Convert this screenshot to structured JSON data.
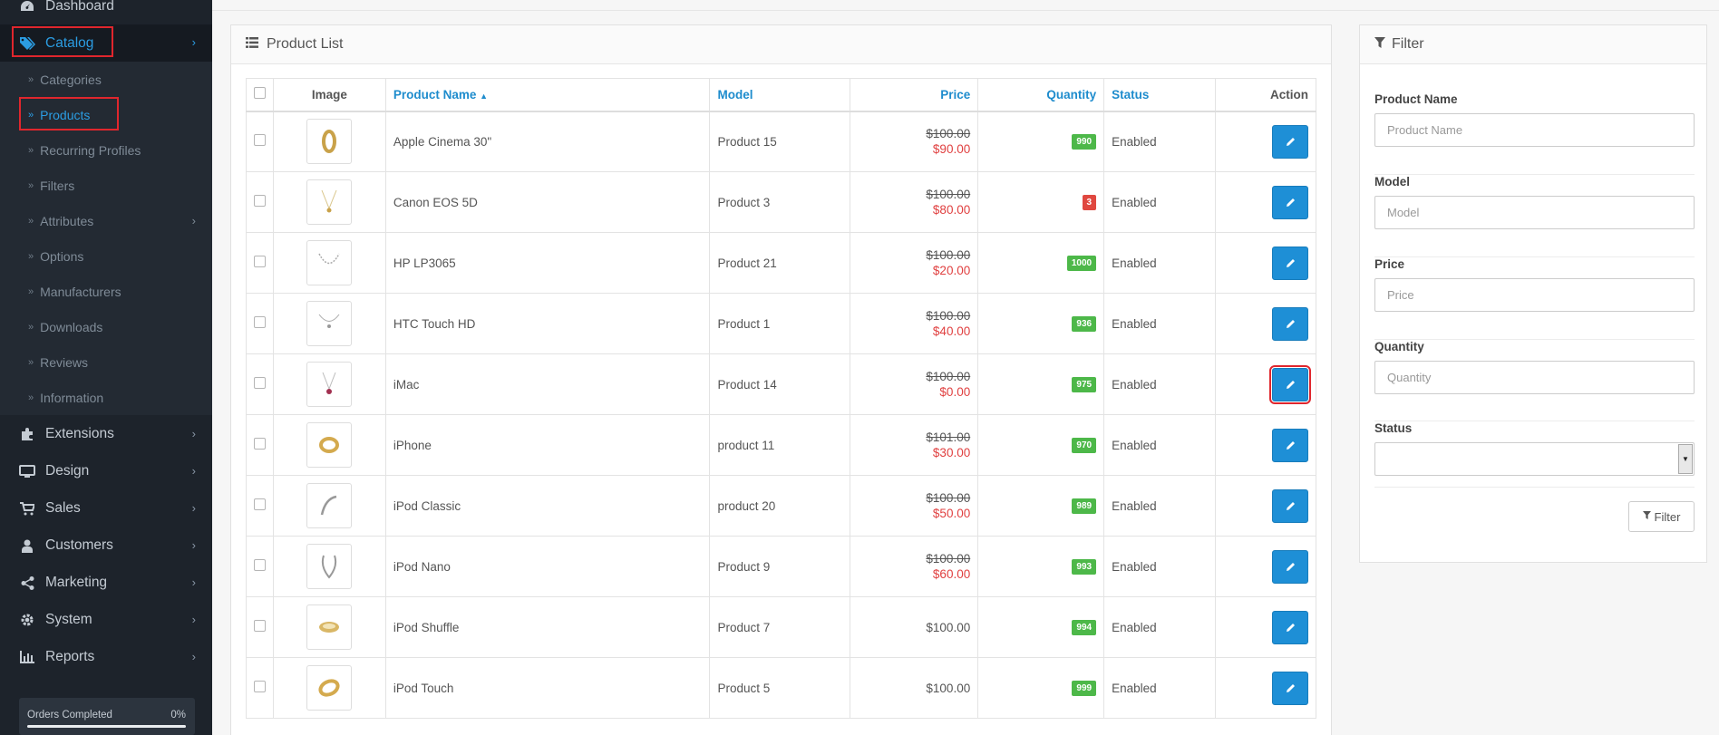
{
  "sidebar": {
    "dashboard": "Dashboard",
    "catalog": "Catalog",
    "catalog_children": [
      {
        "label": "Categories"
      },
      {
        "label": "Products"
      },
      {
        "label": "Recurring Profiles"
      },
      {
        "label": "Filters"
      },
      {
        "label": "Attributes"
      },
      {
        "label": "Options"
      },
      {
        "label": "Manufacturers"
      },
      {
        "label": "Downloads"
      },
      {
        "label": "Reviews"
      },
      {
        "label": "Information"
      }
    ],
    "menus": [
      {
        "label": "Extensions",
        "icon": "puzzle-icon"
      },
      {
        "label": "Design",
        "icon": "monitor-icon"
      },
      {
        "label": "Sales",
        "icon": "cart-icon"
      },
      {
        "label": "Customers",
        "icon": "user-icon"
      },
      {
        "label": "Marketing",
        "icon": "share-icon"
      },
      {
        "label": "System",
        "icon": "gear-icon"
      },
      {
        "label": "Reports",
        "icon": "bar-chart-icon"
      }
    ],
    "progress": {
      "label": "Orders Completed",
      "percent": "0%",
      "value": 0
    }
  },
  "product_list": {
    "title": "Product List",
    "headers": {
      "image": "Image",
      "name": "Product Name",
      "model": "Model",
      "price": "Price",
      "quantity": "Quantity",
      "status": "Status",
      "action": "Action"
    },
    "rows": [
      {
        "name": "Apple Cinema 30\"",
        "model": "Product 15",
        "price": "$100.00",
        "special": "$90.00",
        "quantity": "990",
        "status": "Enabled"
      },
      {
        "name": "Canon EOS 5D",
        "model": "Product 3",
        "price": "$100.00",
        "special": "$80.00",
        "quantity": "3",
        "status": "Enabled"
      },
      {
        "name": "HP LP3065",
        "model": "Product 21",
        "price": "$100.00",
        "special": "$20.00",
        "quantity": "1000",
        "status": "Enabled"
      },
      {
        "name": "HTC Touch HD",
        "model": "Product 1",
        "price": "$100.00",
        "special": "$40.00",
        "quantity": "936",
        "status": "Enabled"
      },
      {
        "name": "iMac",
        "model": "Product 14",
        "price": "$100.00",
        "special": "$0.00",
        "quantity": "975",
        "status": "Enabled"
      },
      {
        "name": "iPhone",
        "model": "product 11",
        "price": "$101.00",
        "special": "$30.00",
        "quantity": "970",
        "status": "Enabled"
      },
      {
        "name": "iPod Classic",
        "model": "product 20",
        "price": "$100.00",
        "special": "$50.00",
        "quantity": "989",
        "status": "Enabled"
      },
      {
        "name": "iPod Nano",
        "model": "Product 9",
        "price": "$100.00",
        "special": "$60.00",
        "quantity": "993",
        "status": "Enabled"
      },
      {
        "name": "iPod Shuffle",
        "model": "Product 7",
        "price": "$100.00",
        "special": "",
        "quantity": "994",
        "status": "Enabled"
      },
      {
        "name": "iPod Touch",
        "model": "Product 5",
        "price": "$100.00",
        "special": "",
        "quantity": "999",
        "status": "Enabled"
      }
    ]
  },
  "filter": {
    "title": "Filter",
    "product_name_label": "Product Name",
    "product_name_placeholder": "Product Name",
    "model_label": "Model",
    "model_placeholder": "Model",
    "price_label": "Price",
    "price_placeholder": "Price",
    "quantity_label": "Quantity",
    "quantity_placeholder": "Quantity",
    "status_label": "Status",
    "status_value": "",
    "button": "Filter"
  },
  "colors": {
    "sidebar_bg": "#1d232b",
    "accent": "#1e8fd6",
    "badge_green": "#4db849",
    "badge_red": "#e04840",
    "special_price": "#e04040",
    "highlight": "#e0262d"
  }
}
